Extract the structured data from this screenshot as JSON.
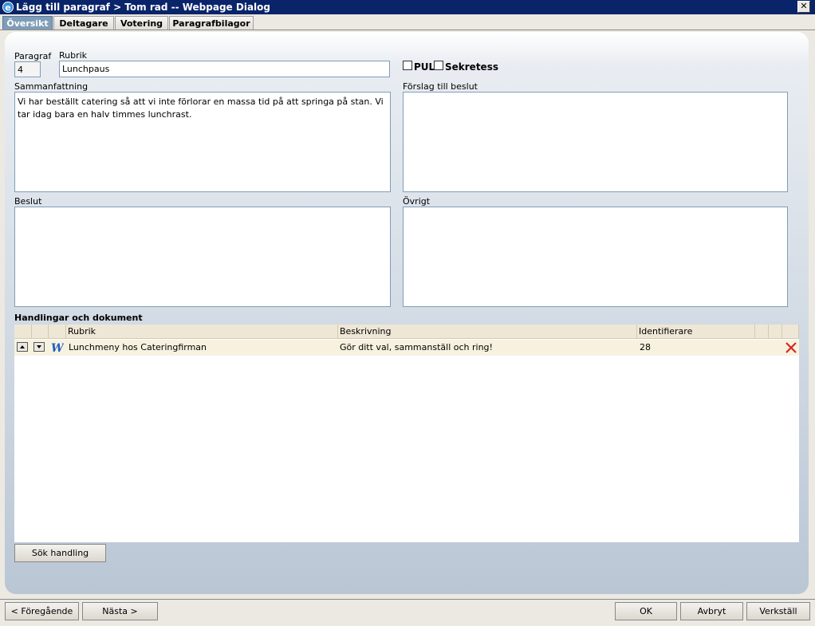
{
  "window": {
    "title": "Lägg till paragraf > Tom rad -- Webpage Dialog",
    "close_label": "✕"
  },
  "tabs": [
    {
      "label": "Översikt",
      "active": true
    },
    {
      "label": "Deltagare",
      "active": false
    },
    {
      "label": "Votering",
      "active": false
    },
    {
      "label": "Paragrafbilagor",
      "active": false
    }
  ],
  "form": {
    "paragraf_label": "Paragraf",
    "paragraf_value": "4",
    "rubrik_label": "Rubrik",
    "rubrik_value": "Lunchpaus",
    "pul_label": "PUL",
    "sekretess_label": "Sekretess",
    "sammanfattning_label": "Sammanfattning",
    "sammanfattning_value": "Vi har beställt catering så att vi inte förlorar en massa tid på att springa på stan. Vi tar idag bara en halv timmes lunchrast.",
    "forslag_label": "Förslag till beslut",
    "forslag_value": "",
    "beslut_label": "Beslut",
    "beslut_value": "",
    "ovrigt_label": "Övrigt",
    "ovrigt_value": ""
  },
  "documents": {
    "section_label": "Handlingar och dokument",
    "columns": [
      "Rubrik",
      "Beskrivning",
      "Identifierare"
    ],
    "rows": [
      {
        "rubrik": "Lunchmeny hos Cateringfirman",
        "beskrivning": "Gör ditt val, sammanställ och ring!",
        "identifierare": "28",
        "icon": "word-document-icon"
      }
    ],
    "search_button": "Sök handling"
  },
  "footer": {
    "prev": "< Föregående",
    "next": "Nästa >",
    "ok": "OK",
    "cancel": "Avbryt",
    "apply": "Verkställ"
  },
  "colors": {
    "titlebar": "#0a246a",
    "active_tab": "#7f9db9",
    "delete_red": "#d9261c",
    "grid_header": "#efe7d6",
    "grid_row": "#f7f2e0"
  }
}
